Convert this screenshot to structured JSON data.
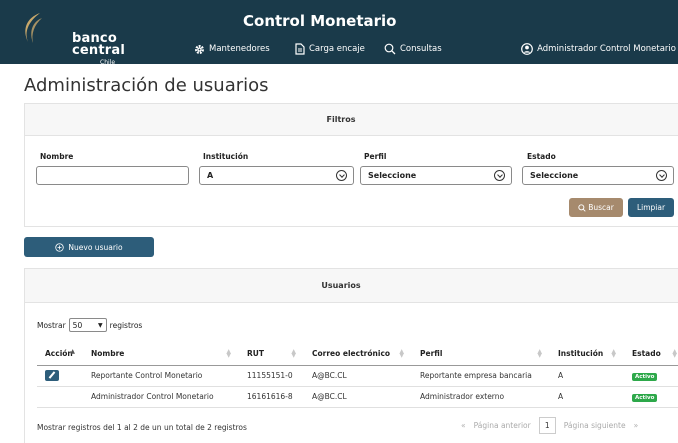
{
  "header": {
    "logo_line1": "banco",
    "logo_line2": "central",
    "logo_line3": "Chile",
    "title": "Control Monetario",
    "nav": [
      {
        "label": "Mantenedores",
        "icon": "gear-icon"
      },
      {
        "label": "Carga encaje",
        "icon": "document-icon"
      },
      {
        "label": "Consultas",
        "icon": "search-icon"
      }
    ],
    "user": {
      "label": "Administrador Control Monetario",
      "icon": "user-circle-icon"
    }
  },
  "page_title": "Administración de usuarios",
  "filters": {
    "title": "Filtros",
    "nombre": {
      "label": "Nombre",
      "value": ""
    },
    "institucion": {
      "label": "Institución",
      "value": "A"
    },
    "perfil": {
      "label": "Perfil",
      "value": "Seleccione"
    },
    "estado": {
      "label": "Estado",
      "value": "Seleccione"
    },
    "search_label": "Buscar",
    "clear_label": "Limpiar"
  },
  "new_user_label": "Nuevo usuario",
  "users": {
    "title": "Usuarios",
    "show_prefix": "Mostrar",
    "page_size": "50",
    "show_suffix": "registros",
    "columns": [
      "Acción",
      "Nombre",
      "RUT",
      "Correo electrónico",
      "Perfil",
      "Institución",
      "Estado"
    ],
    "rows": [
      {
        "nombre": "Reportante Control Monetario",
        "rut": "11155151-0",
        "correo": "A@BC.CL",
        "perfil": "Reportante empresa bancaria",
        "institucion": "A",
        "estado": "Activo",
        "editable": true
      },
      {
        "nombre": "Administrador Control Monetario",
        "rut": "16161616-8",
        "correo": "A@BC.CL",
        "perfil": "Administrador externo",
        "institucion": "A",
        "estado": "Activo",
        "editable": false
      }
    ],
    "info": "Mostrar registros del 1 al 2 de un un total de 2 registros",
    "pager": {
      "first": "«",
      "prev": "Página anterior",
      "current": "1",
      "next": "Página siguiente",
      "last": "»"
    }
  },
  "colors": {
    "header_bg": "#1a3a4a",
    "primary": "#2d5d7a",
    "search_btn": "#a68a6d",
    "active_badge": "#2da84a"
  }
}
